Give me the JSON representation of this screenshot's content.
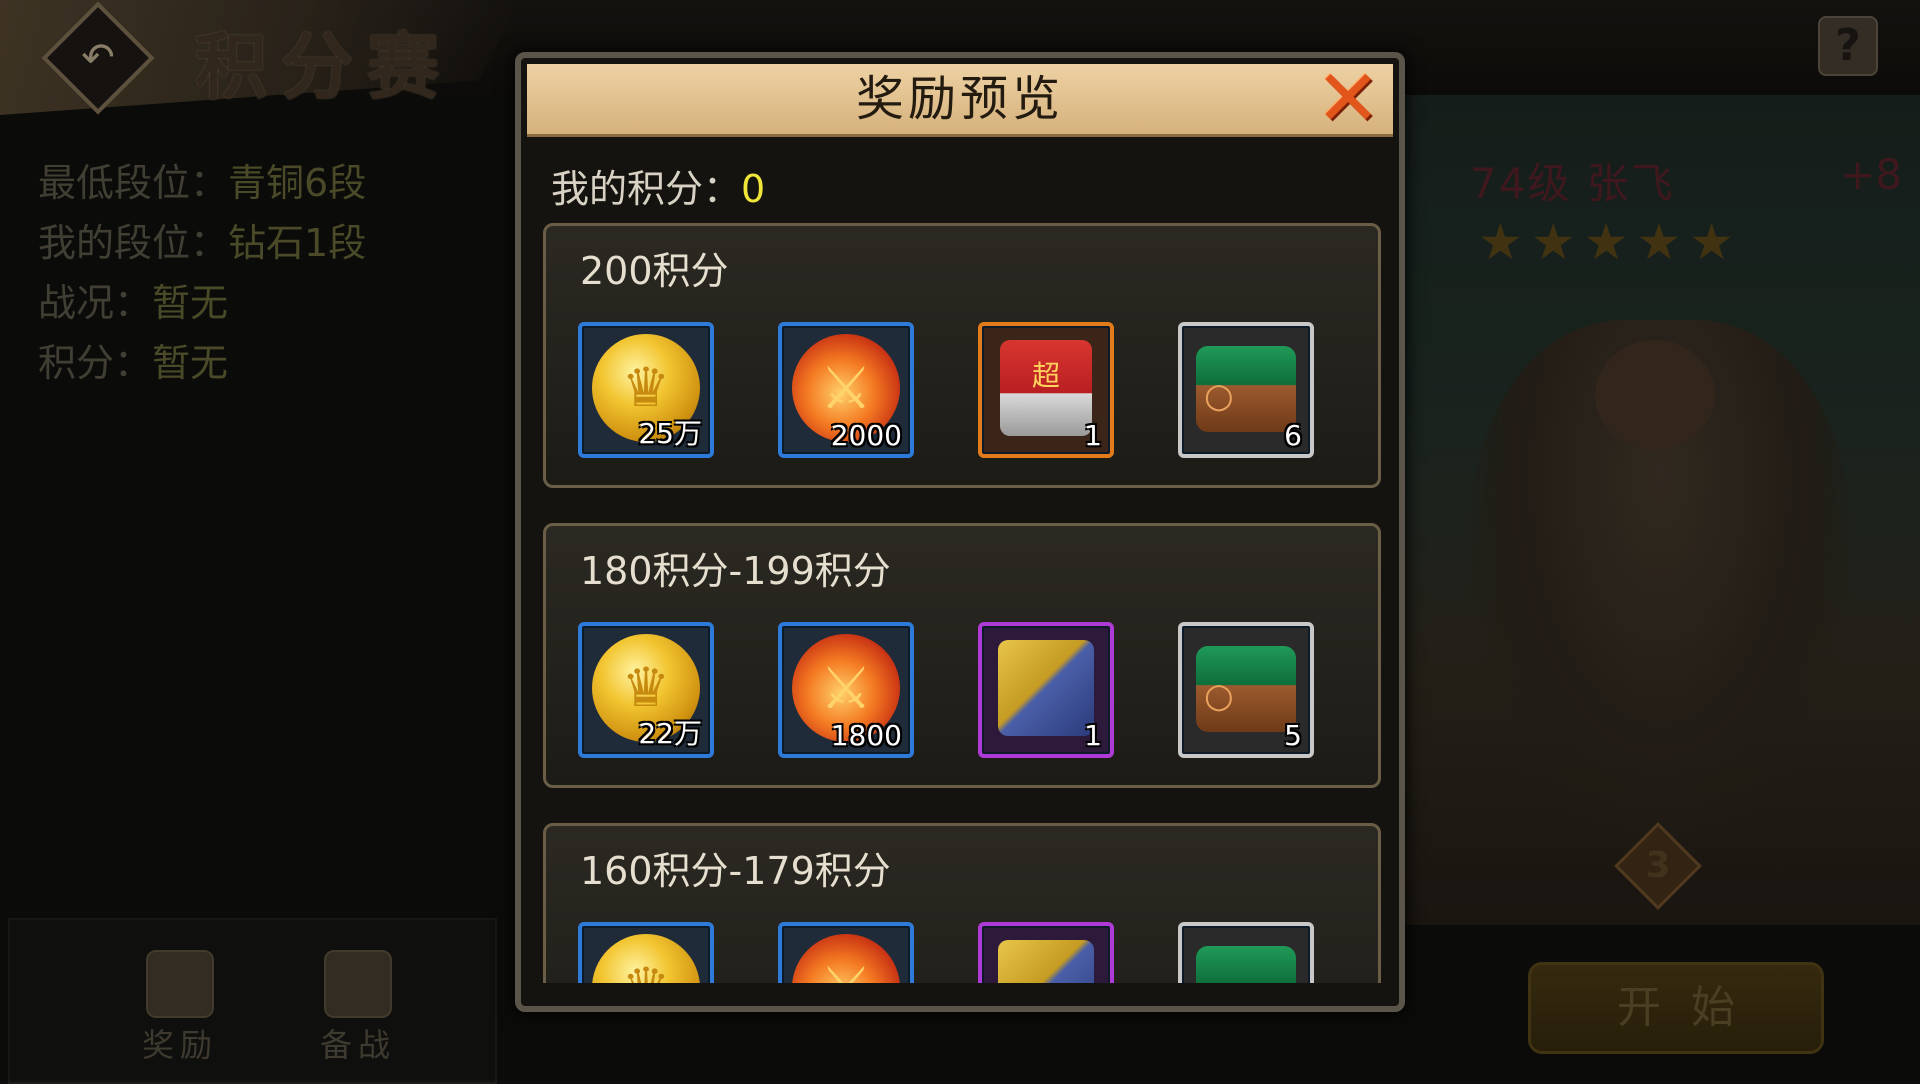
{
  "background": {
    "mode_title": "积分赛",
    "info": [
      {
        "label": "最低段位：",
        "value": "青铜6段"
      },
      {
        "label": "我的段位：",
        "value": "钻石1段"
      },
      {
        "label": "战况：",
        "value": "暂无"
      },
      {
        "label": "积分：",
        "value": "暂无"
      }
    ],
    "help_label": "?",
    "nav": [
      {
        "label": "奖励",
        "icon": "reward-box-icon"
      },
      {
        "label": "备战",
        "icon": "crossed-swords-icon"
      }
    ],
    "hero": {
      "level_name": "74级 张飞",
      "enhance": "+8",
      "stars": "★★★★★",
      "formation_number": "3"
    },
    "start_label": "开始"
  },
  "modal": {
    "title": "奖励预览",
    "close_icon": "close-x-icon",
    "my_score_label": "我的积分：",
    "my_score_value": "0",
    "tiers": [
      {
        "label": "200积分",
        "items": [
          {
            "type": "gold-coin-icon",
            "count": "25万",
            "rarity": "blue"
          },
          {
            "type": "fire-sword-icon",
            "count": "2000",
            "rarity": "blue"
          },
          {
            "type": "super-chest-icon",
            "count": "1",
            "rarity": "orange"
          },
          {
            "type": "green-chest-icon",
            "count": "6",
            "rarity": "white"
          }
        ]
      },
      {
        "label": "180积分-199积分",
        "items": [
          {
            "type": "gold-coin-icon",
            "count": "22万",
            "rarity": "blue"
          },
          {
            "type": "fire-sword-icon",
            "count": "1800",
            "rarity": "blue"
          },
          {
            "type": "advanced-chest-icon",
            "count": "1",
            "rarity": "purple"
          },
          {
            "type": "green-chest-icon",
            "count": "5",
            "rarity": "white"
          }
        ]
      },
      {
        "label": "160积分-179积分",
        "items": [
          {
            "type": "gold-coin-icon",
            "count": "",
            "rarity": "blue"
          },
          {
            "type": "fire-sword-icon",
            "count": "",
            "rarity": "blue"
          },
          {
            "type": "advanced-chest-icon",
            "count": "",
            "rarity": "purple"
          },
          {
            "type": "green-chest-icon",
            "count": "",
            "rarity": "white"
          }
        ]
      }
    ]
  }
}
